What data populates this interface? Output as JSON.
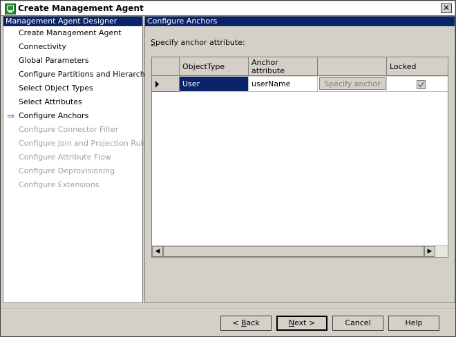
{
  "window": {
    "title": "Create Management Agent"
  },
  "left_panel": {
    "header": "Management Agent Designer",
    "items": [
      {
        "label": "Create Management Agent",
        "enabled": true,
        "current": false
      },
      {
        "label": "Connectivity",
        "enabled": true,
        "current": false
      },
      {
        "label": "Global Parameters",
        "enabled": true,
        "current": false
      },
      {
        "label": "Configure Partitions and Hierarchies",
        "enabled": true,
        "current": false
      },
      {
        "label": "Select Object Types",
        "enabled": true,
        "current": false
      },
      {
        "label": "Select Attributes",
        "enabled": true,
        "current": false
      },
      {
        "label": "Configure Anchors",
        "enabled": true,
        "current": true
      },
      {
        "label": "Configure Connector Filter",
        "enabled": false,
        "current": false
      },
      {
        "label": "Configure Join and Projection Rules",
        "enabled": false,
        "current": false
      },
      {
        "label": "Configure Attribute Flow",
        "enabled": false,
        "current": false
      },
      {
        "label": "Configure Deprovisioning",
        "enabled": false,
        "current": false
      },
      {
        "label": "Configure Extensions",
        "enabled": false,
        "current": false
      }
    ]
  },
  "right_panel": {
    "header": "Configure Anchors",
    "prompt_first": "S",
    "prompt_rest": "pecify anchor attribute:",
    "grid": {
      "headers": {
        "object_type": "ObjectType",
        "anchor_line1": "Anchor",
        "anchor_line2": "attribute",
        "specify": "",
        "locked": "Locked"
      },
      "rows": [
        {
          "object_type": "User",
          "anchor_attribute": "userName",
          "specify_label": "Specify anchor",
          "locked": true
        }
      ]
    }
  },
  "buttons": {
    "back_pre": "< ",
    "back_u": "B",
    "back_rest": "ack",
    "next_u": "N",
    "next_rest": "ext >",
    "cancel": "Cancel",
    "help": "Help"
  }
}
